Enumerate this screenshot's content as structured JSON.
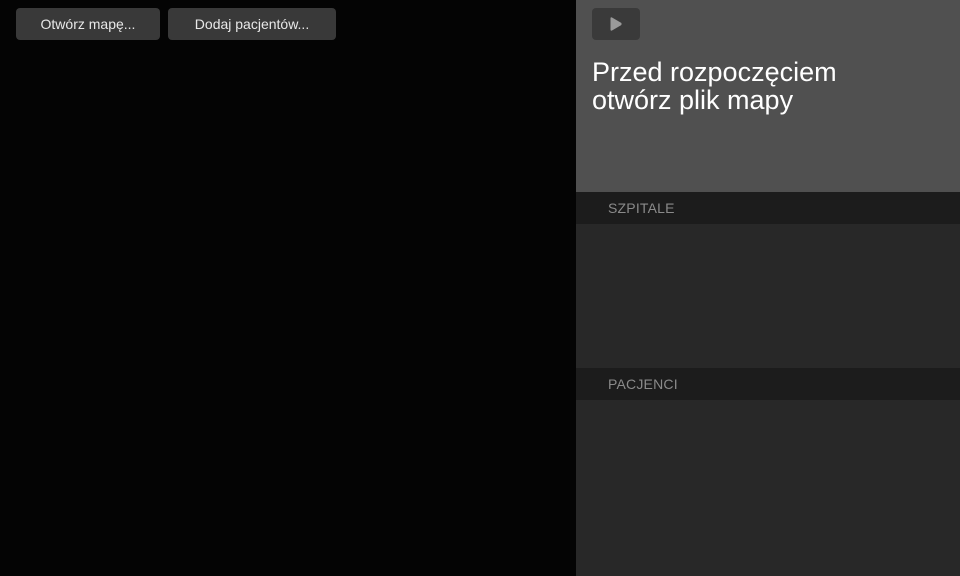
{
  "toolbar": {
    "open_map_label": "Otwórz mapę...",
    "add_patients_label": "Dodaj pacjentów..."
  },
  "side_panel": {
    "play_icon": "play-icon",
    "status_message": "Przed rozpoczęciem\notwórz plik mapy",
    "hospitals_header": "SZPITALE",
    "patients_header": "PACJENCI"
  },
  "colors": {
    "map_background": "#040404",
    "button_background": "#393939",
    "status_background": "#505050",
    "panel_background": "#282828",
    "section_header_background": "#1c1c1c",
    "section_header_text": "#8a8a8a"
  }
}
